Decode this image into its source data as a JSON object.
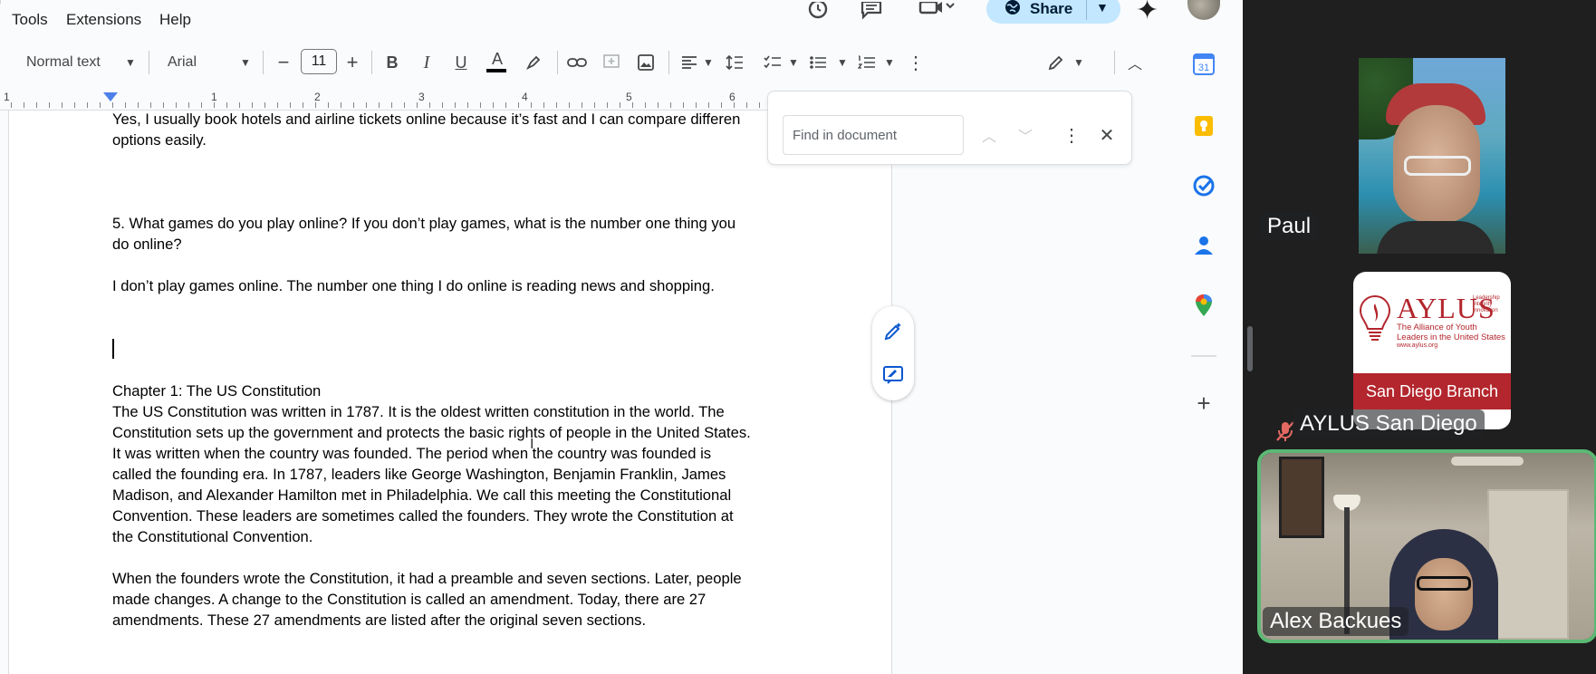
{
  "menubar": {
    "items": [
      "Tools",
      "Extensions",
      "Help"
    ]
  },
  "header": {
    "share_label": "Share"
  },
  "toolbar": {
    "style_select": "Normal text",
    "font_select": "Arial",
    "font_size": "11"
  },
  "ruler": {
    "numbers": [
      "1",
      "1",
      "2",
      "3",
      "4",
      "5",
      "6"
    ]
  },
  "find": {
    "placeholder": "Find in document"
  },
  "document": {
    "lines": [
      "Yes, I usually book hotels and airline tickets online because it’s fast and I can compare differen",
      "options easily.",
      "5. What games do you play online? If you don’t play games, what is the number one thing you",
      "do online?",
      "I don’t play games online. The number one thing I do online is reading news and shopping.",
      "Chapter 1: The US Constitution",
      "The US Constitution was written in 1787. It is the oldest written constitution in the world. The",
      "Constitution sets up the government and protects the basic rights of people in the United States.",
      "It was written when the country was founded. The period when the country was founded is",
      "called the founding era. In 1787, leaders like George Washington, Benjamin Franklin, James",
      "Madison, and Alexander Hamilton met in Philadelphia. We call this meeting the Constitutional",
      "Convention. These leaders are sometimes called the founders. They wrote the Constitution at",
      "the Constitutional Convention.",
      "When the founders wrote the Constitution, it had a preamble and seven sections. Later, people",
      "made changes. A change to the Constitution is called an amendment. Today, there are 27",
      "amendments. These 27 amendments are listed after the original seven sections."
    ]
  },
  "side_panel": {
    "calendar_day": "31"
  },
  "meeting": {
    "participants": [
      {
        "name": "Paul"
      },
      {
        "name": "AYLUS San Diego"
      },
      {
        "name": "Alex Backues"
      }
    ],
    "aylus_card": {
      "title": "AYLUS",
      "tags": [
        "Leadership",
        "Integrity",
        "Innovation"
      ],
      "tagline": "The Alliance of Youth Leaders in the United States",
      "url": "www.aylus.org",
      "branch": "San Diego Branch"
    }
  },
  "colors": {
    "share_bg": "#c2e7ff",
    "active_speaker_border": "#5bb974",
    "aylus_red": "#b3262d",
    "accent_blue": "#0b57d0"
  }
}
